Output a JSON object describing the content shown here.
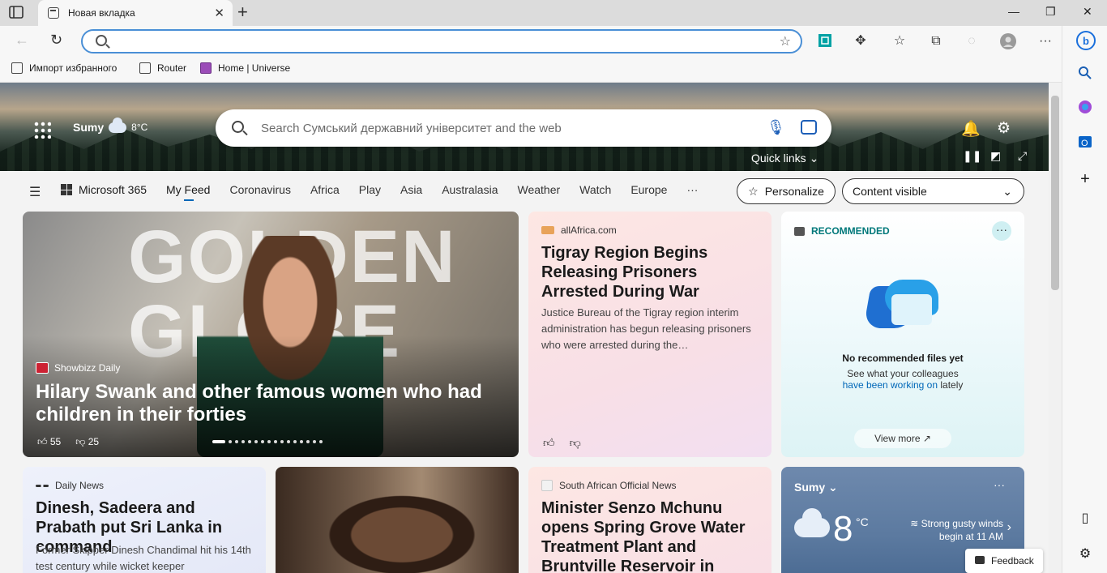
{
  "tab": {
    "title": "Новая вкладка",
    "close": "✕",
    "new_tab": "+"
  },
  "window": {
    "minimize": "—",
    "restore": "❐",
    "close": "✕"
  },
  "toolbar": {
    "back": "←",
    "reload": "↻",
    "address_value": "",
    "more": "···"
  },
  "bookmarks": [
    "Импорт избранного",
    "Router",
    "Home | Universe"
  ],
  "hero": {
    "city": "Sumy",
    "temp": "8",
    "temp_unit": "°C",
    "search_placeholder": "Search Сумський державний університет and the web",
    "quick_links": "Quick links"
  },
  "feed_nav": {
    "ms365": "Microsoft 365",
    "tabs": [
      "My Feed",
      "Coronavirus",
      "Africa",
      "Play",
      "Asia",
      "Australasia",
      "Weather",
      "Watch",
      "Europe",
      "···"
    ],
    "active_tab": "My Feed",
    "personalize": "Personalize",
    "content_visible": "Content visible"
  },
  "cards": {
    "hero": {
      "bg_text": "GOLDEN GLOBE",
      "source": "Showbizz Daily",
      "title": "Hilary Swank and other famous women who had children in their forties",
      "likes": "55",
      "dislikes": "25",
      "slide_count": 16,
      "slide_index": 0
    },
    "tigray": {
      "source": "allAfrica.com",
      "title": "Tigray Region Begins Releasing Prisoners Arrested During War",
      "desc": "Justice Bureau of the Tigray region interim administration has begun releasing prisoners who were arrested during the…"
    },
    "recommended": {
      "header": "RECOMMENDED",
      "more": "···",
      "none": "No recommended files yet",
      "sub_1": "See what your colleagues",
      "sub_link": "have been working on",
      "sub_2": "lately",
      "view_more": "View more"
    },
    "daily": {
      "source": "Daily News",
      "title": "Dinesh, Sadeera and Prabath put Sri Lanka in command",
      "desc": "Former Skipper Dinesh Chandimal hit his 14th test century while wicket keeper"
    },
    "minister": {
      "source": "South African Official News",
      "title": "Minister Senzo Mchunu opens Spring Grove Water Treatment Plant and Bruntville Reservoir in"
    },
    "weather": {
      "city": "Sumy",
      "more": "···",
      "temp": "8",
      "unit": "°C",
      "wind": "Strong gusty winds begin at 11 AM"
    }
  },
  "feedback": "Feedback"
}
